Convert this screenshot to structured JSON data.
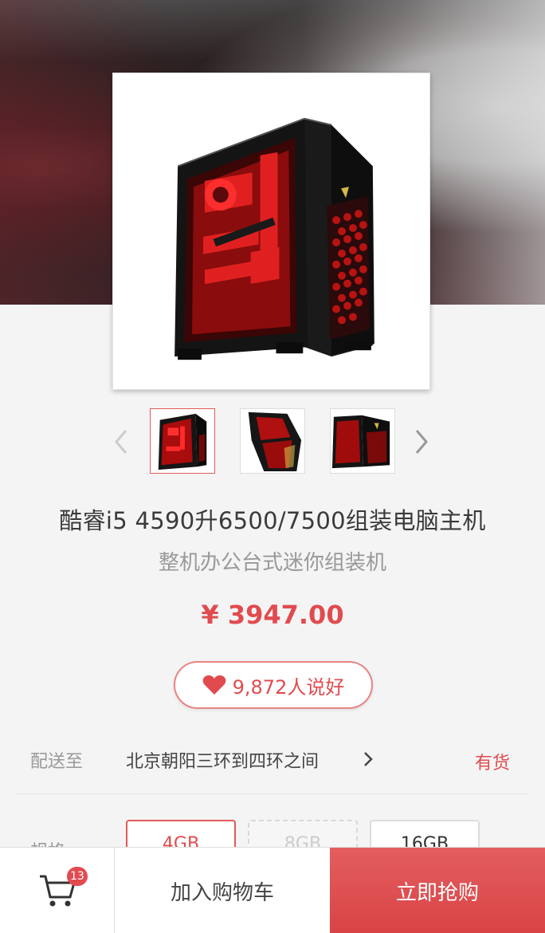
{
  "product": {
    "title": "酷睿i5 4590升6500/7500组装电脑主机",
    "subtitle": "整机办公台式迷你组装机",
    "price": "¥ 3947.00",
    "likes": "9,872人说好"
  },
  "delivery": {
    "label": "配送至",
    "address": "北京朝阳三环到四环之间",
    "stock": "有货"
  },
  "spec": {
    "label": "规格",
    "options": [
      {
        "label": "4GB",
        "state": "selected"
      },
      {
        "label": "8GB",
        "state": "disabled"
      },
      {
        "label": "16GB",
        "state": "normal"
      }
    ]
  },
  "bottom_bar": {
    "cart_count": "13",
    "add_to_cart": "加入购物车",
    "buy_now": "立即抢购"
  },
  "colors": {
    "accent": "#e14b4f",
    "buy_button": "#dd4f51",
    "case_red": "#d81818"
  },
  "icons": [
    "chevron-left-icon",
    "chevron-right-icon",
    "heart-icon",
    "cart-icon"
  ]
}
